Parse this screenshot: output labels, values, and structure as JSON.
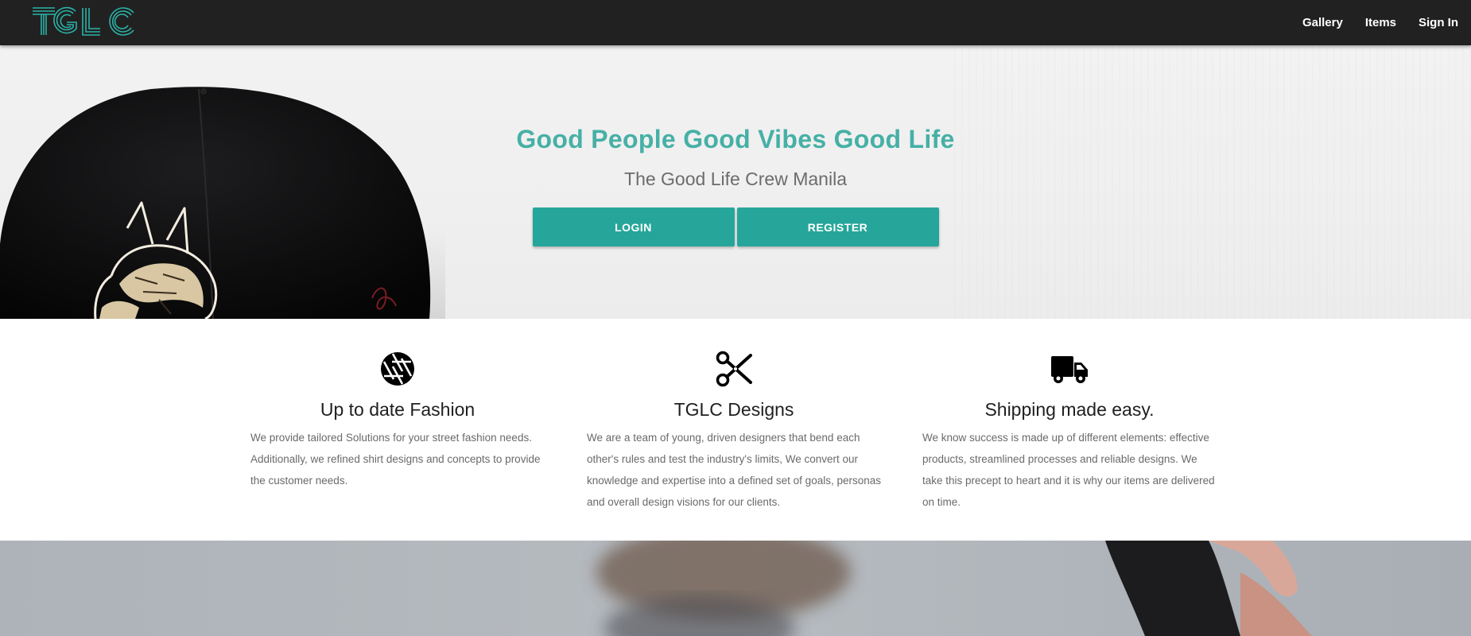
{
  "nav": {
    "logo_text": "TGLC",
    "links": [
      {
        "label": "Gallery"
      },
      {
        "label": "Items"
      },
      {
        "label": "Sign In"
      }
    ]
  },
  "hero": {
    "title": "Good People Good Vibes Good Life",
    "subtitle": "The Good Life Crew Manila",
    "buttons": {
      "login": "LOGIN",
      "register": "REGISTER"
    }
  },
  "features": [
    {
      "icon": "aperture-icon",
      "title": "Up to date Fashion",
      "description": "We provide tailored Solutions for your street fashion needs. Additionally, we refined shirt designs and concepts to provide the customer needs."
    },
    {
      "icon": "scissors-icon",
      "title": "TGLC Designs",
      "description": "We are a team of young, driven designers that bend each other's rules and test the industry's limits, We convert our knowledge and expertise into a defined set of goals, personas and overall design visions for our clients."
    },
    {
      "icon": "truck-icon",
      "title": "Shipping made easy.",
      "description": "We know success is made up of different elements: effective products, streamlined processes and reliable designs. We take this precept to heart and it is why our items are delivered on time."
    }
  ],
  "colors": {
    "navbar": "#212121",
    "accent": "#26a69a",
    "title_accent": "#46b0a6"
  }
}
